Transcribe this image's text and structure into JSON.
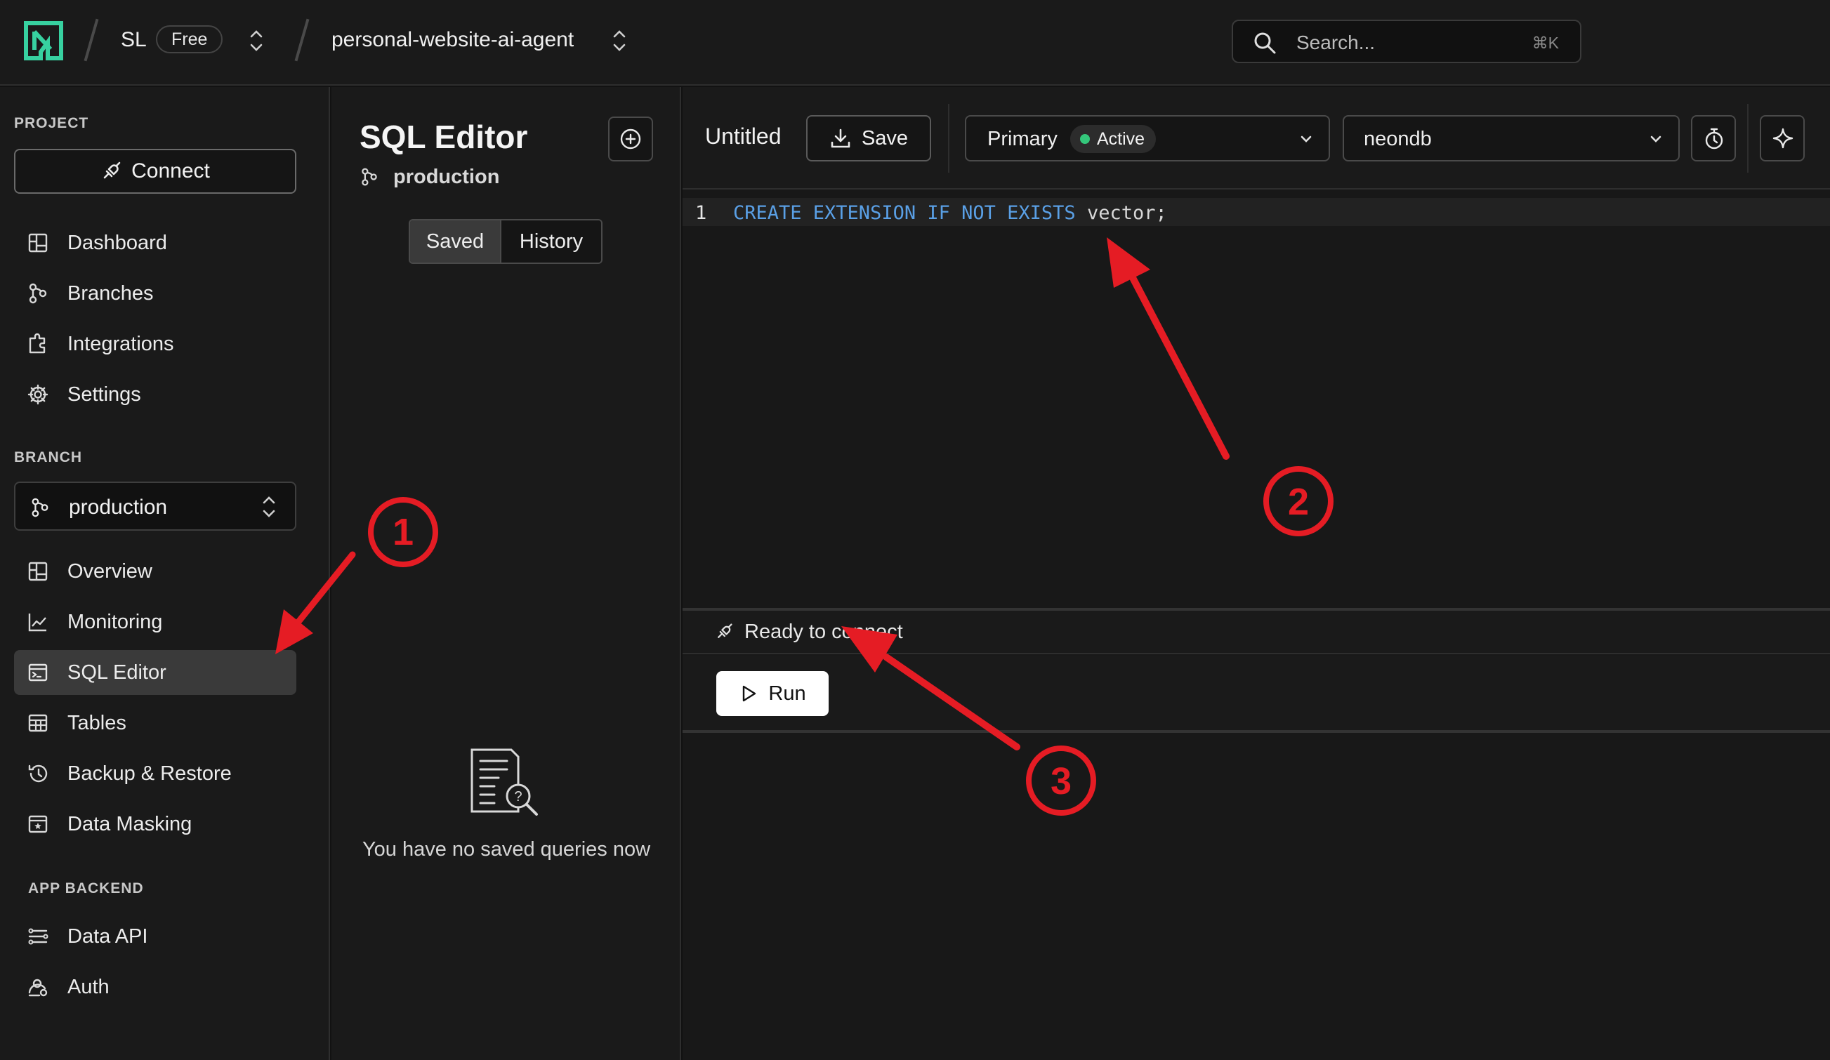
{
  "header": {
    "org_initials": "SL",
    "plan": "Free",
    "project_name": "personal-website-ai-agent",
    "search": {
      "placeholder": "Search...",
      "shortcut": "⌘K"
    }
  },
  "sidebar": {
    "project_label": "PROJECT",
    "connect_label": "Connect",
    "project_items": [
      {
        "label": "Dashboard",
        "icon": "dashboard-icon"
      },
      {
        "label": "Branches",
        "icon": "branches-icon"
      },
      {
        "label": "Integrations",
        "icon": "integrations-icon"
      },
      {
        "label": "Settings",
        "icon": "gear-icon"
      }
    ],
    "branch_label": "BRANCH",
    "branch_selected": "production",
    "branch_items": [
      {
        "label": "Overview",
        "icon": "overview-icon"
      },
      {
        "label": "Monitoring",
        "icon": "monitoring-icon"
      },
      {
        "label": "SQL Editor",
        "icon": "sql-editor-icon",
        "active": true
      },
      {
        "label": "Tables",
        "icon": "tables-icon"
      },
      {
        "label": "Backup & Restore",
        "icon": "backup-restore-icon"
      },
      {
        "label": "Data Masking",
        "icon": "data-masking-icon"
      }
    ],
    "app_backend_label": "APP BACKEND",
    "backend_items": [
      {
        "label": "Data API",
        "icon": "data-api-icon"
      },
      {
        "label": "Auth",
        "icon": "auth-icon"
      }
    ]
  },
  "sql_panel": {
    "title": "SQL Editor",
    "branch": "production",
    "tabs": [
      "Saved",
      "History"
    ],
    "active_tab": "Saved",
    "empty_message": "You have no saved queries now"
  },
  "editor": {
    "query_title": "Untitled",
    "save_label": "Save",
    "compute": {
      "label": "Primary",
      "status": "Active"
    },
    "database": "neondb",
    "code": {
      "line_number": "1",
      "keywords": "CREATE EXTENSION IF NOT EXISTS",
      "identifier": "vector;"
    },
    "connection_status": "Ready to connect",
    "run_label": "Run"
  },
  "annotations": {
    "step_1": "1",
    "step_2": "2",
    "step_3": "3"
  },
  "colors": {
    "annotation": "#e51c24",
    "status_active": "#34c77b",
    "brand": "#37d1a0",
    "keyword": "#5aa0e6"
  }
}
